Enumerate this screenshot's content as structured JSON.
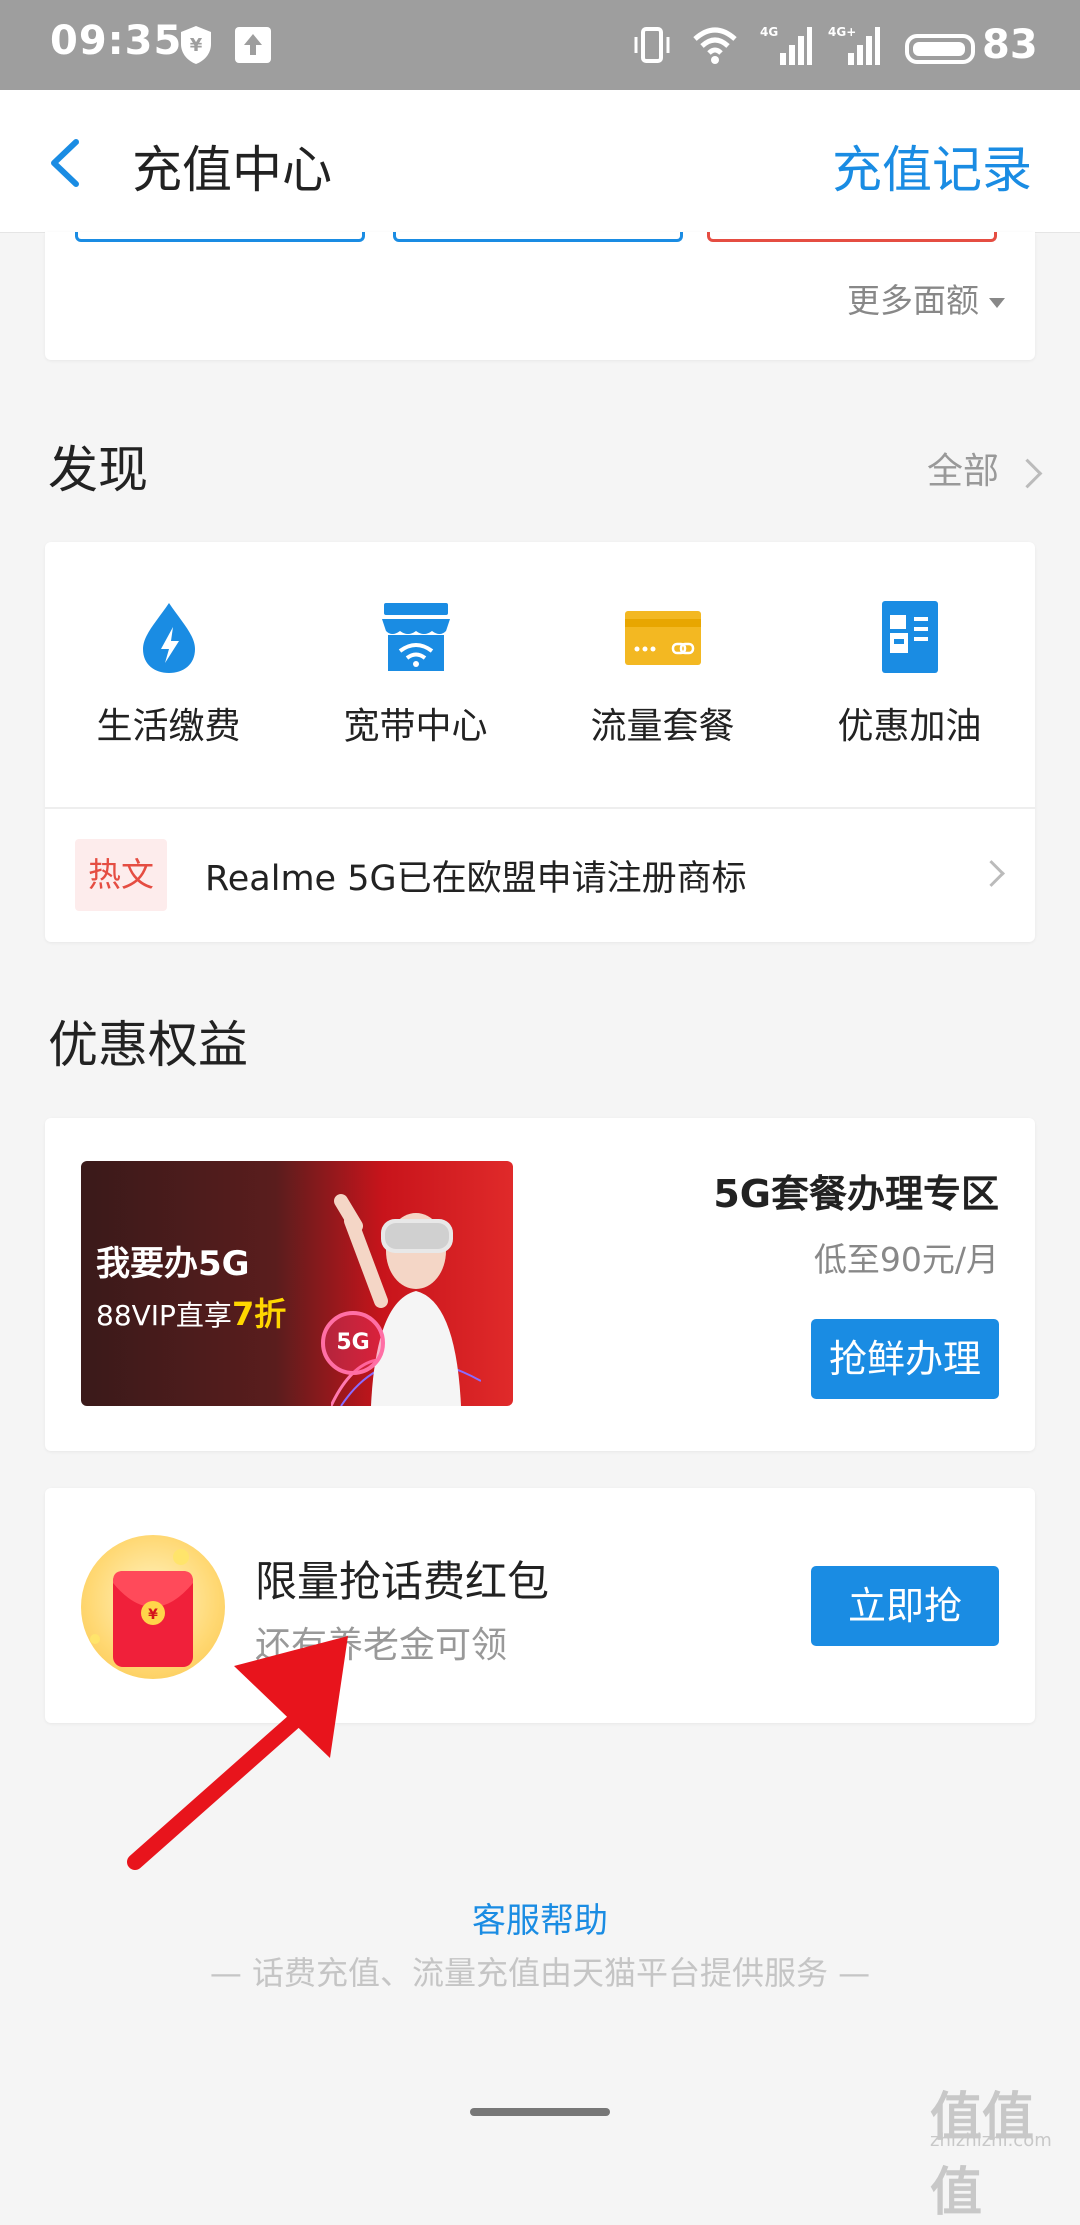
{
  "status_bar": {
    "time": "09:35",
    "battery": "83",
    "icons": [
      "shield-yen-icon",
      "upload-icon",
      "vibrate-icon",
      "wifi-icon",
      "signal-4g-icon",
      "signal-4g-plus-icon",
      "battery-icon"
    ]
  },
  "nav": {
    "title": "充值中心",
    "right_link": "充值记录"
  },
  "amount_section": {
    "more_label": "更多面额"
  },
  "discover": {
    "title": "发现",
    "see_all": "全部",
    "services": [
      {
        "label": "生活缴费",
        "icon": "water-drop-bolt-icon",
        "color": "#1a8ce3"
      },
      {
        "label": "宽带中心",
        "icon": "broadband-store-icon",
        "color": "#1a8ce3"
      },
      {
        "label": "流量套餐",
        "icon": "data-card-icon",
        "color": "#f3b822"
      },
      {
        "label": "优惠加油",
        "icon": "fuel-pump-icon",
        "color": "#1a8ce3"
      }
    ],
    "hot": {
      "tag": "热文",
      "text": "Realme 5G已在欧盟申请注册商标"
    }
  },
  "benefits": {
    "title": "优惠权益",
    "promo": {
      "banner_line1": "我要办5G",
      "banner_line2_prefix": "88VIP直享",
      "banner_line2_highlight": "7折",
      "banner_badge": "5G",
      "title": "5G套餐办理专区",
      "subtitle": "低至90元/月",
      "button": "抢鲜办理"
    },
    "red_packet": {
      "title": "限量抢话费红包",
      "subtitle": "还有养老金可领",
      "button": "立即抢"
    }
  },
  "footer": {
    "help": "客服帮助",
    "note": "— 话费充值、流量充值由天猫平台提供服务 —"
  },
  "watermark": {
    "logo": "值值值",
    "url": "zhizhizhi.com"
  },
  "colors": {
    "accent": "#1a8ce3",
    "hot_red": "#e54d42",
    "annotation_arrow": "#e8141c"
  }
}
